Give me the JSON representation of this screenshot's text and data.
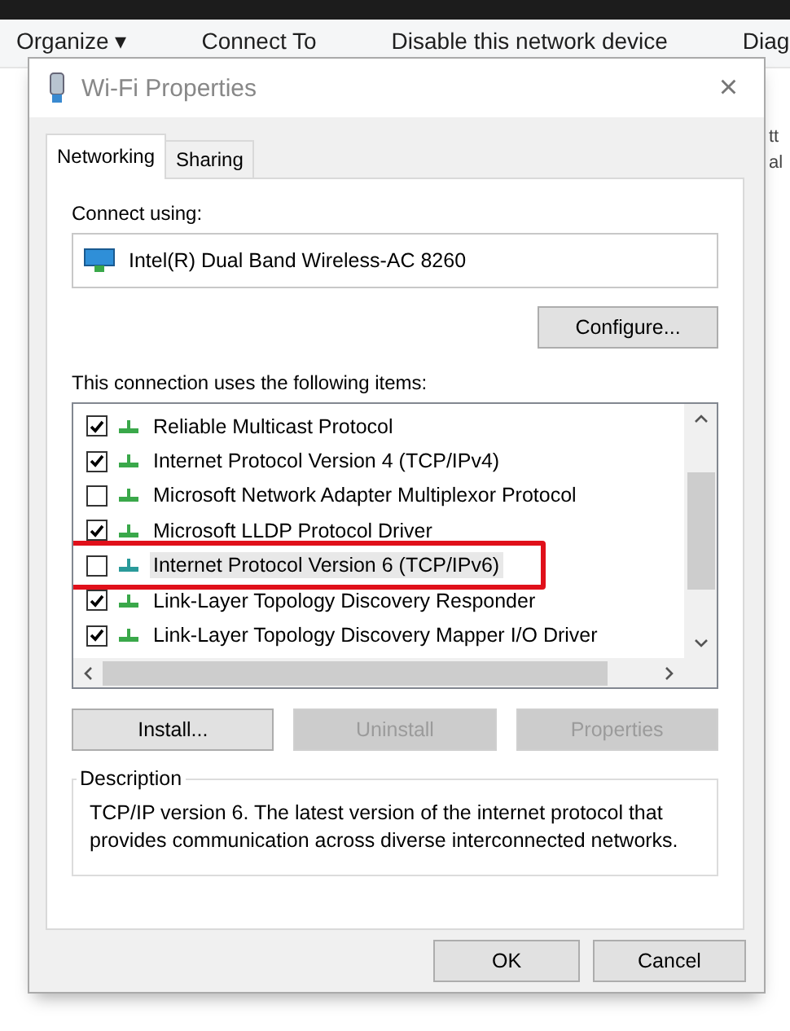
{
  "background": {
    "toolbar": [
      "Organize ▾",
      "Connect To",
      "Disable this network device",
      "Diag"
    ],
    "side_text": [
      "tt",
      "al"
    ]
  },
  "window": {
    "title": "Wi-Fi Properties",
    "close": "×"
  },
  "tabs": [
    {
      "label": "Networking",
      "selected": true
    },
    {
      "label": "Sharing",
      "selected": false
    }
  ],
  "connect_using": {
    "label": "Connect using:",
    "adapter": "Intel(R) Dual Band Wireless-AC 8260",
    "button": "Configure..."
  },
  "items": {
    "label": "This connection uses the following items:",
    "rows": [
      {
        "name": "Reliable Multicast Protocol",
        "checked": true,
        "selected": false,
        "highlighted": false
      },
      {
        "name": "Internet Protocol Version 4 (TCP/IPv4)",
        "checked": true,
        "selected": false,
        "highlighted": false
      },
      {
        "name": "Microsoft Network Adapter Multiplexor Protocol",
        "checked": false,
        "selected": false,
        "highlighted": false
      },
      {
        "name": "Microsoft LLDP Protocol Driver",
        "checked": true,
        "selected": false,
        "highlighted": false
      },
      {
        "name": "Internet Protocol Version 6 (TCP/IPv6)",
        "checked": false,
        "selected": true,
        "highlighted": true
      },
      {
        "name": "Link-Layer Topology Discovery Responder",
        "checked": true,
        "selected": false,
        "highlighted": false
      },
      {
        "name": "Link-Layer Topology Discovery Mapper I/O Driver",
        "checked": true,
        "selected": false,
        "highlighted": false
      }
    ]
  },
  "item_buttons": [
    {
      "label": "Install...",
      "disabled": false
    },
    {
      "label": "Uninstall",
      "disabled": true
    },
    {
      "label": "Properties",
      "disabled": true
    }
  ],
  "description": {
    "title": "Description",
    "text": "TCP/IP version 6. The latest version of the internet protocol that provides communication across diverse interconnected networks."
  },
  "footer_buttons": [
    "OK",
    "Cancel"
  ]
}
